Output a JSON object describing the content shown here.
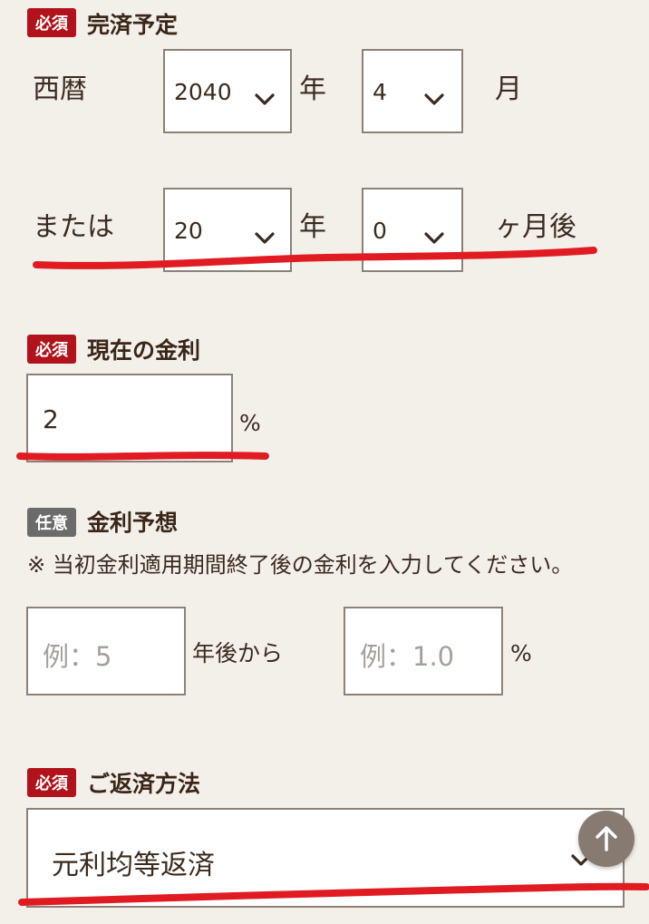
{
  "completion": {
    "badge": "必須",
    "title": "完済予定",
    "era_label": "西暦",
    "year_value": "2040",
    "year_unit": "年",
    "month_value": "4",
    "month_unit": "月",
    "or_label": "または",
    "years_after_value": "20",
    "years_after_unit": "年",
    "months_after_value": "0",
    "months_after_unit": "ヶ月後"
  },
  "current_rate": {
    "badge": "必須",
    "title": "現在の金利",
    "value": "2",
    "unit": "%"
  },
  "rate_forecast": {
    "badge": "任意",
    "title": "金利予想",
    "note": "※ 当初金利適用期間終了後の金利を入力してください。",
    "years_placeholder": "例：5",
    "years_suffix": "年後から",
    "rate_placeholder": "例：1.0",
    "rate_unit": "%"
  },
  "repayment": {
    "badge": "必須",
    "title": "ご返済方法",
    "selected": "元利均等返済"
  },
  "icons": {
    "scroll_top": "arrow-up-icon",
    "chevron": "chevron-down-icon"
  },
  "colors": {
    "required_badge": "#b1121b",
    "optional_badge": "#6b6b6b",
    "annotation_line": "#e01b22",
    "background": "#f3f0ea"
  }
}
